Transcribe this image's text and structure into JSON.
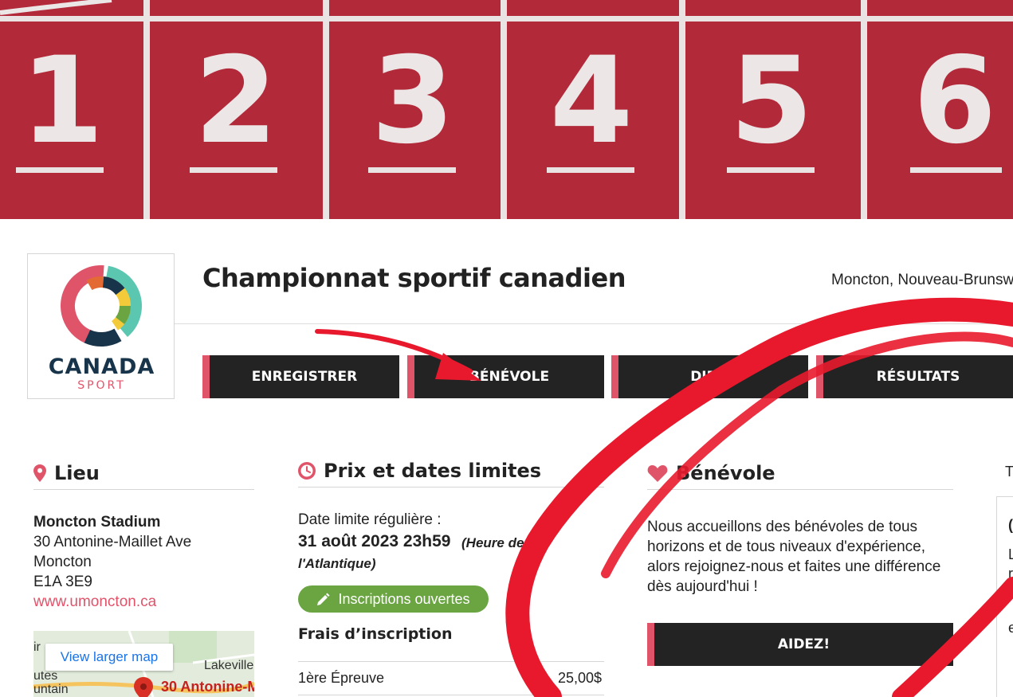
{
  "hero": {
    "lane_numbers": [
      "1",
      "2",
      "3",
      "4",
      "5",
      "6"
    ],
    "track_color": "#b22a3a"
  },
  "logo": {
    "word": "CANADA",
    "sub": "SPORT"
  },
  "header": {
    "title": "Championnat sportif canadien",
    "location": "Moncton, Nouveau-Brunsw"
  },
  "nav": [
    {
      "label": "ENREGISTRER"
    },
    {
      "label": "BÉNÉVOLE"
    },
    {
      "label": "DIREC"
    },
    {
      "label": "RÉSULTATS"
    }
  ],
  "lieu": {
    "heading": "Lieu",
    "venue": "Moncton Stadium",
    "address_1": "30 Antonine-Maillet Ave",
    "city": "Moncton",
    "postal": "E1A 3E9",
    "website": "www.umoncton.ca",
    "map": {
      "button": "View larger map",
      "place_1": "Lakeville",
      "place_2": "ir",
      "place_3": "utes",
      "place_4": "untain",
      "pin_label": "30 Antonine-M"
    }
  },
  "prix": {
    "heading": "Prix et dates limites",
    "deadline_label": "Date limite régulière :",
    "deadline_date": "31 août 2023 23h59",
    "deadline_note_1": "(Heure de",
    "deadline_note_2": "l'Atlantique)",
    "status": "Inscriptions ouvertes",
    "fees_title": "Frais d’inscription",
    "fees": [
      {
        "name": "1ère Épreuve",
        "price": "25,00$"
      }
    ]
  },
  "benevole": {
    "heading": "Bénévole",
    "text": "Nous accueillons des bénévoles de tous horizons et de tous niveaux d'expérience, alors rejoignez-nous et faites une différence dès aujourd'hui !",
    "button": "AIDEZ!"
  },
  "right_column": {
    "letter_1": "T",
    "letter_2": "(",
    "letter_3": "L",
    "letter_4": "r",
    "letter_5": "i",
    "letter_6": "e"
  },
  "colors": {
    "accent": "#e0546a",
    "button_bg": "#232323",
    "badge_green": "#6aa542",
    "annotation_red": "#e8192c"
  },
  "icons": {
    "lieu": "map-pin-icon",
    "prix": "clock-icon",
    "benevole": "heart-icon",
    "badge": "pencil-icon"
  }
}
